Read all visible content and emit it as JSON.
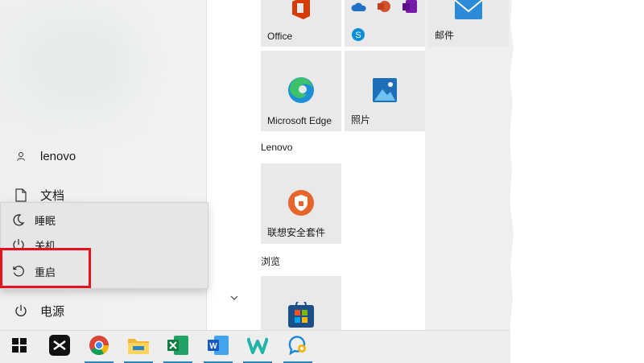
{
  "user": {
    "name": "lenovo"
  },
  "left_rail": {
    "documents": "文档",
    "power": "电源"
  },
  "power_menu": {
    "sleep": "睡眠",
    "shutdown": "关机",
    "restart": "重启"
  },
  "tiles": {
    "office": "Office",
    "mail": "邮件",
    "edge": "Microsoft Edge",
    "photos": "照片",
    "lenovo_security": "联想安全套件",
    "store": "Microsoft Store"
  },
  "groups": {
    "lenovo": "Lenovo",
    "browse": "浏览"
  },
  "taskbar": {
    "items": [
      "start-icon",
      "capcut-icon",
      "chrome-icon",
      "file-explorer-icon",
      "excel-icon",
      "word-icon",
      "wps-icon",
      "quick-assist-icon"
    ]
  },
  "colors": {
    "highlight": "#e8101a",
    "accent": "#2a86c8"
  }
}
